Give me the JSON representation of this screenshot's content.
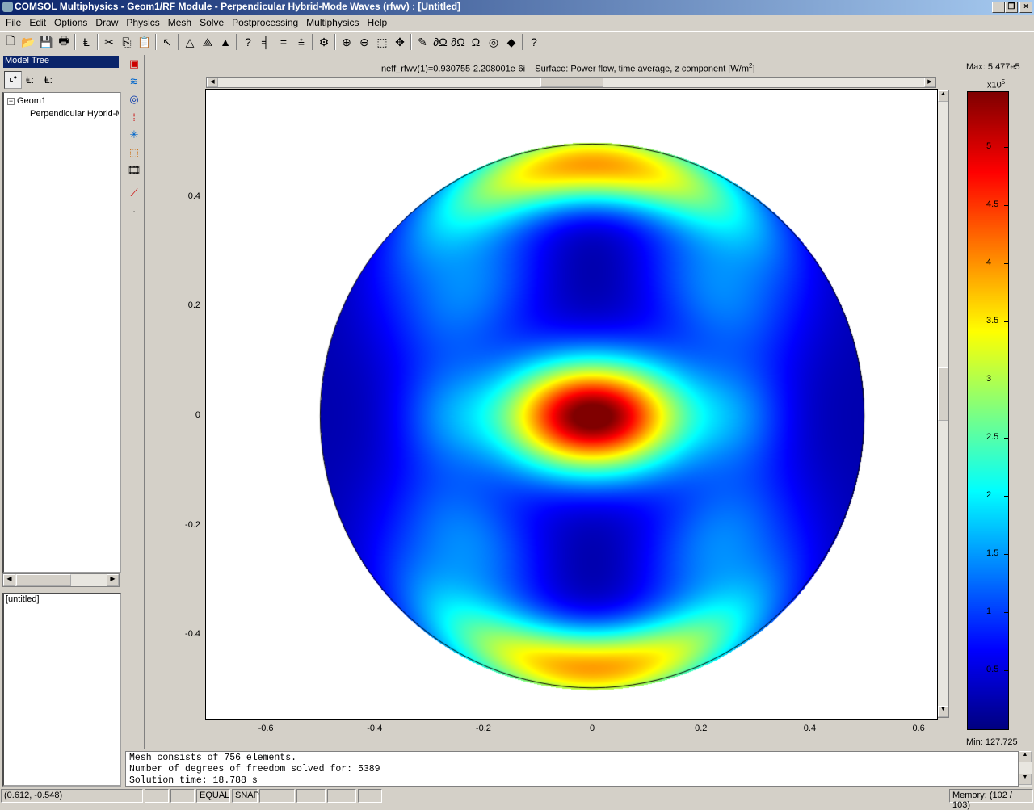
{
  "window": {
    "title": "COMSOL Multiphysics - Geom1/RF Module - Perpendicular Hybrid-Mode Waves (rfwv) : [Untitled]"
  },
  "menu": [
    "File",
    "Edit",
    "Options",
    "Draw",
    "Physics",
    "Mesh",
    "Solve",
    "Postprocessing",
    "Multiphysics",
    "Help"
  ],
  "toolbar_icons": [
    "new-icon",
    "open-icon",
    "save-icon",
    "print-icon",
    "model-tree-icon",
    "cut-icon",
    "copy-icon",
    "paste-icon",
    "select-icon",
    "draw-triangle-icon",
    "mesh-icon",
    "refine-mesh-icon",
    "point-settings-icon",
    "edge-settings-icon",
    "boundary-settings-icon",
    "subdomain-settings-icon",
    "solve-icon",
    "zoom-in-icon",
    "zoom-out-icon",
    "zoom-window-icon",
    "zoom-extents-icon",
    "scalar-variables-icon",
    "boundary-mode-icon",
    "subdomain-mode-icon",
    "point-mode-icon",
    "mesh-mode-icon",
    "postprocessing-mode-icon",
    "help-icon"
  ],
  "toolbar_glyphs": [
    "🗋",
    "📂",
    "💾",
    "🖶",
    "Ⱡ",
    "✂",
    "⎘",
    "📋",
    "↖",
    "△",
    "⟁",
    "▲",
    "?",
    "╡",
    "=",
    "⩮",
    "⚙",
    "⊕",
    "⊖",
    "⬚",
    "✥",
    "✎",
    "∂Ω",
    "∂Ω",
    "Ω",
    "◎",
    "◆",
    "?"
  ],
  "vtool_icons": [
    "surface-plot-icon",
    "contour-plot-icon",
    "boundary-plot-icon",
    "arrow-plot-icon",
    "principal-plot-icon",
    "deformed-plot-icon",
    "animate-icon",
    "line-plot-icon",
    "point-plot-icon"
  ],
  "vtool_glyphs": [
    "▣",
    "≋",
    "◎",
    "⁞",
    "✳",
    "⬚",
    "🎞",
    "⟋",
    "·"
  ],
  "model_tree": {
    "header": "Model Tree",
    "root": "Geom1",
    "child": "Perpendicular Hybrid-Mode Waves (rfwv)"
  },
  "second_panel": "[untitled]",
  "plot": {
    "title_left": "neff_rfwv(1)=0.930755-2.208001e-6i",
    "title_right": "Surface: Power flow, time average, z component [W/m",
    "title_sup": "2",
    "title_end": "]",
    "x_ticks": [
      "-0.6",
      "-0.4",
      "-0.2",
      "0",
      "0.2",
      "0.4",
      "0.6"
    ],
    "y_ticks": [
      "0.4",
      "0.2",
      "0",
      "-0.2",
      "-0.4"
    ],
    "xlim": [
      -0.71,
      0.634
    ],
    "ylim": [
      -0.553,
      0.596
    ],
    "domain_radius": 0.5
  },
  "colorbar": {
    "max_label": "Max: 5.477e5",
    "min_label": "Min: 127.725",
    "scale": "x10",
    "scale_exp": "5",
    "ticks": [
      "5",
      "4.5",
      "4",
      "3.5",
      "3",
      "2.5",
      "2",
      "1.5",
      "1",
      "0.5"
    ],
    "range": [
      0.00127725,
      5.477
    ],
    "colormap": "jet"
  },
  "messages": [
    "Mesh consists of 756 elements.",
    "Number of degrees of freedom solved for: 5389",
    "Solution time: 18.788 s"
  ],
  "status": {
    "coords": "(0.612, -0.548)",
    "equal": "EQUAL",
    "snap": "SNAP",
    "memory": "Memory: (102 / 103)"
  }
}
